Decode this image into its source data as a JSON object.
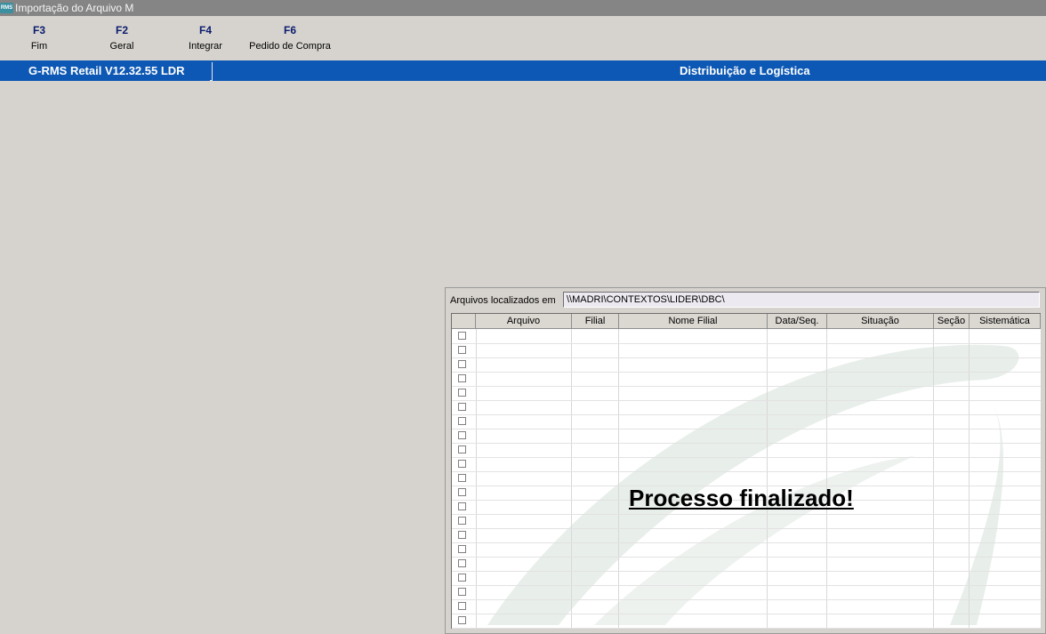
{
  "window": {
    "icon_text": "RMS",
    "title": "Importação do Arquivo M"
  },
  "toolbar": {
    "buttons": [
      {
        "key": "F3",
        "label": "Fim"
      },
      {
        "key": "F2",
        "label": "Geral"
      },
      {
        "key": "F4",
        "label": "Integrar"
      },
      {
        "key": "F6",
        "label": "Pedido de Compra"
      }
    ]
  },
  "banner": {
    "product": "G-RMS Retail V12.32.55 LDR",
    "module": "Distribuição e Logística"
  },
  "files": {
    "path_label": "Arquivos localizados em",
    "path_value": "\\\\MADRI\\CONTEXTOS\\LIDER\\DBC\\",
    "columns": [
      "Arquivo",
      "Filial",
      "Nome Filial",
      "Data/Seq.",
      "Situação",
      "Seção",
      "Sistemática"
    ],
    "row_count": 21,
    "status_message": "Processo finalizado!"
  },
  "colors": {
    "banner": "#0d58b4",
    "titlebar": "#858585",
    "background": "#d6d3ce"
  }
}
